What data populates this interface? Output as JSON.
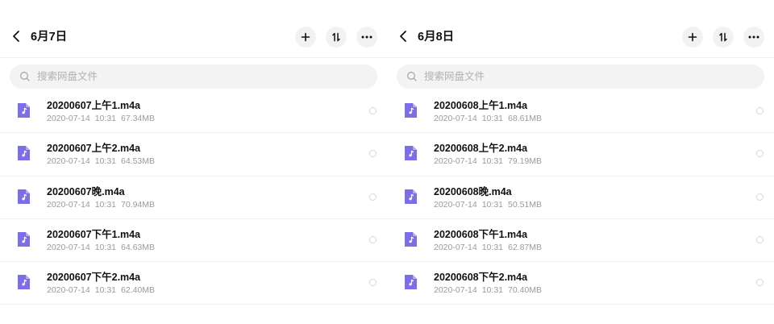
{
  "colors": {
    "accent": "#7b6ee6",
    "muted": "#9a9a9a",
    "search_bg": "#f3f3f3"
  },
  "panels": [
    {
      "title": "6月7日",
      "search_placeholder": "搜索网盘文件",
      "files": [
        {
          "name": "20200607上午1.m4a",
          "date": "2020-07-14",
          "time": "10:31",
          "size": "67.34MB"
        },
        {
          "name": "20200607上午2.m4a",
          "date": "2020-07-14",
          "time": "10:31",
          "size": "64.53MB"
        },
        {
          "name": "20200607晚.m4a",
          "date": "2020-07-14",
          "time": "10:31",
          "size": "70.94MB"
        },
        {
          "name": "20200607下午1.m4a",
          "date": "2020-07-14",
          "time": "10:31",
          "size": "64.63MB"
        },
        {
          "name": "20200607下午2.m4a",
          "date": "2020-07-14",
          "time": "10:31",
          "size": "62.40MB"
        }
      ]
    },
    {
      "title": "6月8日",
      "search_placeholder": "搜索网盘文件",
      "files": [
        {
          "name": "20200608上午1.m4a",
          "date": "2020-07-14",
          "time": "10:31",
          "size": "68.61MB"
        },
        {
          "name": "20200608上午2.m4a",
          "date": "2020-07-14",
          "time": "10:31",
          "size": "79.19MB"
        },
        {
          "name": "20200608晚.m4a",
          "date": "2020-07-14",
          "time": "10:31",
          "size": "50.51MB"
        },
        {
          "name": "20200608下午1.m4a",
          "date": "2020-07-14",
          "time": "10:31",
          "size": "62.87MB"
        },
        {
          "name": "20200608下午2.m4a",
          "date": "2020-07-14",
          "time": "10:31",
          "size": "70.40MB"
        }
      ]
    }
  ],
  "icons": {
    "back": "chevron-left-icon",
    "add": "plus-icon",
    "sort": "sort-icon",
    "more": "more-dots-icon",
    "search": "search-icon",
    "file": "audio-file-icon",
    "select": "radio-circle-icon"
  }
}
